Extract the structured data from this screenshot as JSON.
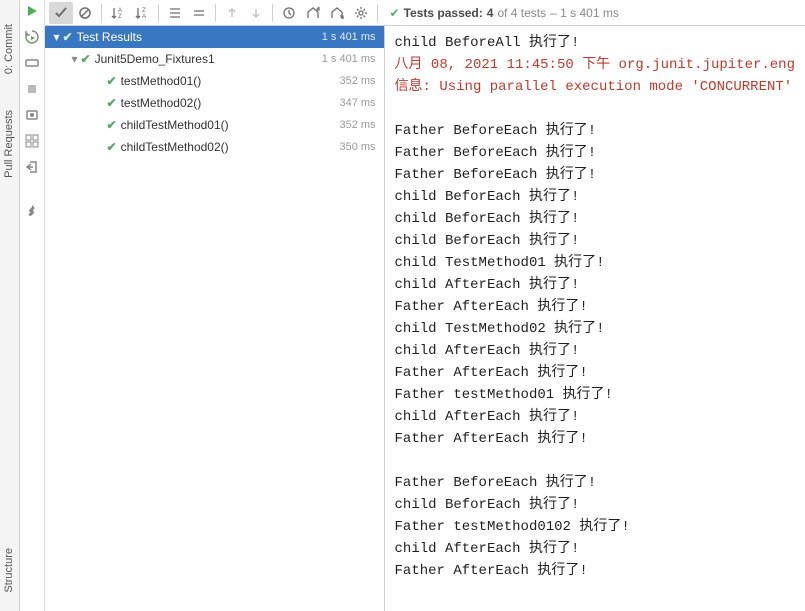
{
  "leftTabs": {
    "commit": "0: Commit",
    "pullRequests": "Pull Requests",
    "structure": "Structure"
  },
  "toolbar": {
    "summary_prefix": "Tests passed:",
    "summary_passed": "4",
    "summary_mid": "of 4 tests",
    "summary_time": "– 1 s 401 ms"
  },
  "tree": {
    "root": {
      "label": "Test Results",
      "time": "1 s 401 ms"
    },
    "suite": {
      "label": "Junit5Demo_Fixtures1",
      "time": "1 s 401 ms"
    },
    "tests": [
      {
        "label": "testMethod01()",
        "time": "352 ms"
      },
      {
        "label": "testMethod02()",
        "time": "347 ms"
      },
      {
        "label": "childTestMethod01()",
        "time": "352 ms"
      },
      {
        "label": "childTestMethod02()",
        "time": "350 ms"
      }
    ]
  },
  "console": {
    "lines": [
      {
        "text": "child BeforeAll 执行了!",
        "cls": ""
      },
      {
        "text": "八月 08, 2021 11:45:50 下午 org.junit.jupiter.eng",
        "cls": "red"
      },
      {
        "text": "信息: Using parallel execution mode 'CONCURRENT'",
        "cls": "red"
      },
      {
        "text": "",
        "cls": "empty"
      },
      {
        "text": "Father BeforeEach 执行了!",
        "cls": ""
      },
      {
        "text": "Father BeforeEach 执行了!",
        "cls": ""
      },
      {
        "text": "Father BeforeEach 执行了!",
        "cls": ""
      },
      {
        "text": "child BeforEach 执行了!",
        "cls": ""
      },
      {
        "text": "child BeforEach 执行了!",
        "cls": ""
      },
      {
        "text": "child BeforEach 执行了!",
        "cls": ""
      },
      {
        "text": "child TestMethod01 执行了!",
        "cls": ""
      },
      {
        "text": "child AfterEach 执行了!",
        "cls": ""
      },
      {
        "text": "Father AfterEach 执行了!",
        "cls": ""
      },
      {
        "text": "child TestMethod02 执行了!",
        "cls": ""
      },
      {
        "text": "child AfterEach 执行了!",
        "cls": ""
      },
      {
        "text": "Father AfterEach 执行了!",
        "cls": ""
      },
      {
        "text": "Father testMethod01 执行了!",
        "cls": ""
      },
      {
        "text": "child AfterEach 执行了!",
        "cls": ""
      },
      {
        "text": "Father AfterEach 执行了!",
        "cls": ""
      },
      {
        "text": "",
        "cls": "empty"
      },
      {
        "text": "Father BeforeEach 执行了!",
        "cls": ""
      },
      {
        "text": "child BeforEach 执行了!",
        "cls": ""
      },
      {
        "text": "Father testMethod0102 执行了!",
        "cls": ""
      },
      {
        "text": "child AfterEach 执行了!",
        "cls": ""
      },
      {
        "text": "Father AfterEach 执行了!",
        "cls": ""
      }
    ]
  }
}
